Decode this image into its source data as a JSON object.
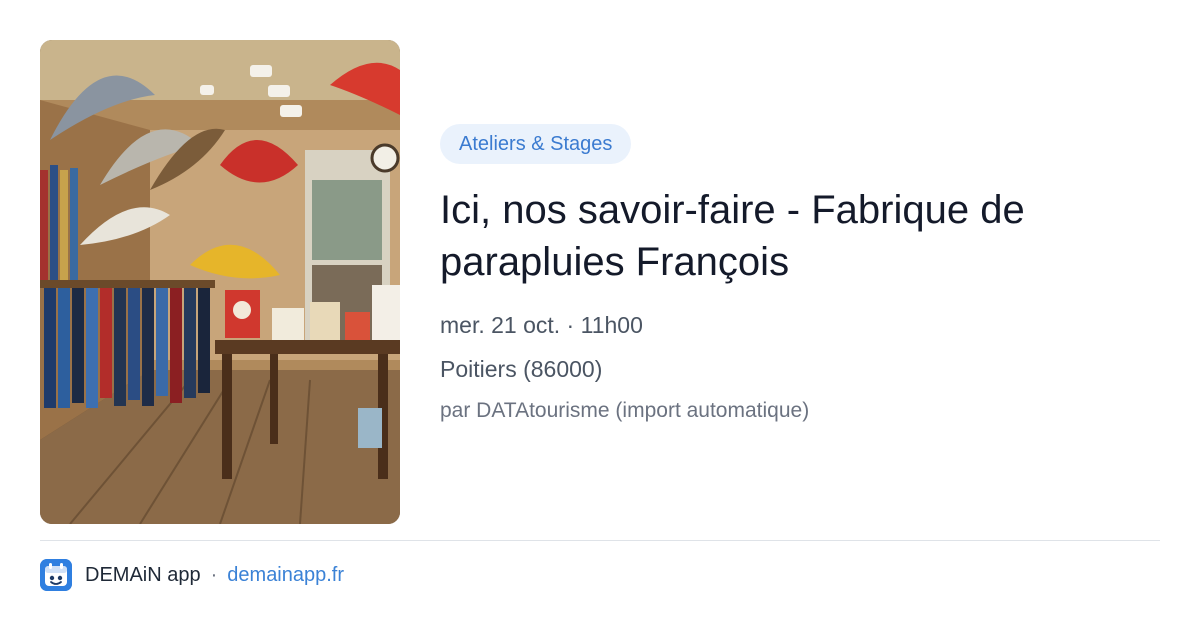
{
  "event": {
    "category": "Ateliers & Stages",
    "title": "Ici, nos savoir-faire - Fabrique de parapluies François",
    "date": "mer. 21 oct. · 11h00",
    "location": "Poitiers (86000)",
    "source": "par DATAtourisme (import automatique)"
  },
  "footer": {
    "app_name": "DEMAiN app",
    "separator": "·",
    "link": "demainapp.fr"
  },
  "colors": {
    "badge_bg": "#eaf2fc",
    "badge_text": "#3b7bd0",
    "link": "#3b82d6",
    "app_icon": "#2f7fe0"
  },
  "icons": {
    "app": "demain-app-icon"
  }
}
